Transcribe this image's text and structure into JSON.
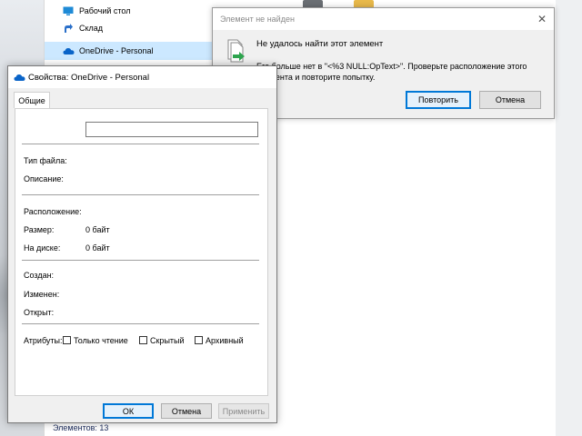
{
  "explorer": {
    "nav": [
      {
        "label": "Рабочий стол",
        "icon": "desktop-icon"
      },
      {
        "label": "Склад",
        "icon": "shortcut-arrow-icon"
      },
      {
        "label": "OneDrive - Personal",
        "icon": "onedrive-cloud-icon",
        "selected": true
      }
    ],
    "status": "Элементов: 13"
  },
  "error_dialog": {
    "title": "Элемент не найден",
    "heading": "Не удалось найти этот элемент",
    "message": "Его больше нет в \"<%3 NULL:OpText>\". Проверьте расположение этого элемента и повторите попытку.",
    "retry_label": "Повторить",
    "cancel_label": "Отмена",
    "icon": "file-moved-icon"
  },
  "properties_dialog": {
    "title": "Свойства: OneDrive - Personal",
    "tab": "Общие",
    "name_value": "",
    "fields": {
      "type_label": "Тип файла:",
      "desc_label": "Описание:",
      "location_label": "Расположение:",
      "size_label": "Размер:",
      "size_value": "0 байт",
      "ondisk_label": "На диске:",
      "ondisk_value": "0 байт",
      "created_label": "Создан:",
      "modified_label": "Изменен:",
      "opened_label": "Открыт:"
    },
    "attributes": {
      "label": "Атрибуты:",
      "readonly": "Только чтение",
      "hidden": "Скрытый",
      "archive": "Архивный"
    },
    "buttons": {
      "ok": "ОК",
      "cancel": "Отмена",
      "apply": "Применить"
    }
  },
  "colors": {
    "accent": "#0078d7",
    "selection": "#cce8ff",
    "disabled_text": "#8a8a8a"
  }
}
